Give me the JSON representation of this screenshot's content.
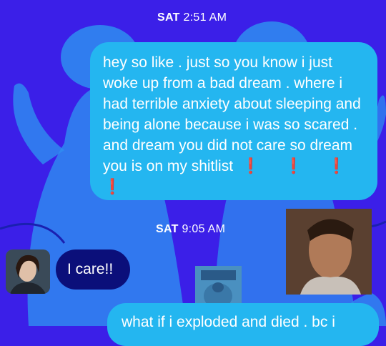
{
  "colors": {
    "background": "#3b1fe8",
    "outgoing_bubble": "#24b6f0",
    "incoming_bubble": "#0b0f7a",
    "alert": "#e02020"
  },
  "timestamps": [
    {
      "day": "SAT",
      "time": "2:51 AM"
    },
    {
      "day": "SAT",
      "time": "9:05 AM"
    }
  ],
  "messages": [
    {
      "direction": "outgoing",
      "text": "hey so like . just so you know i just woke up from a bad dream . where i had terrible anxiety about sleeping and being alone because i was so scared . and dream you did not care so dream you is on my shitlist",
      "emphasis": "❗ ❗ ❗ ❗"
    },
    {
      "direction": "incoming",
      "text": "I care!!"
    },
    {
      "direction": "outgoing",
      "text": "what if i exploded and died . bc i"
    }
  ]
}
